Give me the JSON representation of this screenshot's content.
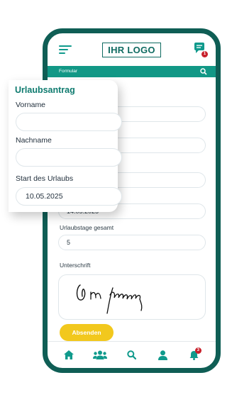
{
  "app": {
    "logo_text": "IHR LOGO",
    "chat_badge": "1",
    "form_bar_label": "Formular",
    "accent_color": "#129886",
    "frame_color": "#0f5e55",
    "button_color": "#f2c81d"
  },
  "phone_form": {
    "end_date_value": "14.05.2025",
    "days_label": "Urlaubstage gesamt",
    "days_value": "5",
    "signature_label": "Unterschrift",
    "submit_label": "Absenden"
  },
  "nav": {
    "items": [
      "home-icon",
      "users-icon",
      "search-icon",
      "user-icon",
      "bell-icon"
    ],
    "bell_badge": "3"
  },
  "card": {
    "title": "Urlaubsantrag",
    "first_name_label": "Vorname",
    "first_name_value": "",
    "last_name_label": "Nachname",
    "last_name_value": "",
    "start_label": "Start des Urlaubs",
    "start_value": "10.05.2025"
  }
}
